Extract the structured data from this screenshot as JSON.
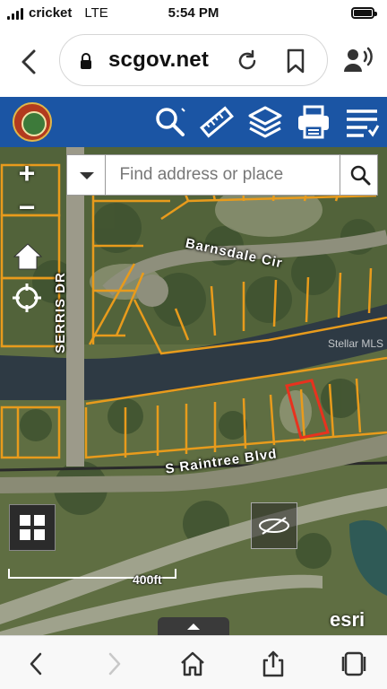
{
  "status_bar": {
    "carrier": "cricket",
    "network": "LTE",
    "time": "5:54 PM"
  },
  "browser": {
    "url": "scgov.net",
    "icons": [
      "back-chevron-icon",
      "lock-icon",
      "reload-icon",
      "bookmark-icon",
      "voice-icon"
    ]
  },
  "toolbar": {
    "icons": [
      "search-icon",
      "measure-ruler-icon",
      "layers-icon",
      "print-icon",
      "menu-list-icon"
    ],
    "bg_color": "#1b55a4"
  },
  "map": {
    "search_placeholder": "Find address or place",
    "zoom_in": "+",
    "zoom_out": "−",
    "road_labels": {
      "barnsdale": "Barnsdale Cir",
      "serris": "SERRIS DR",
      "raintree": "S Raintree Blvd"
    },
    "watermark": "Stellar MLS",
    "scale_label": "400ft",
    "attribution": "esri",
    "parcel_color": "#e89b1c",
    "selected_parcel_color": "#e8321e"
  },
  "bottom_bar": {
    "icons": [
      "back-icon",
      "forward-icon",
      "home-icon",
      "share-icon",
      "tabs-icon"
    ]
  }
}
